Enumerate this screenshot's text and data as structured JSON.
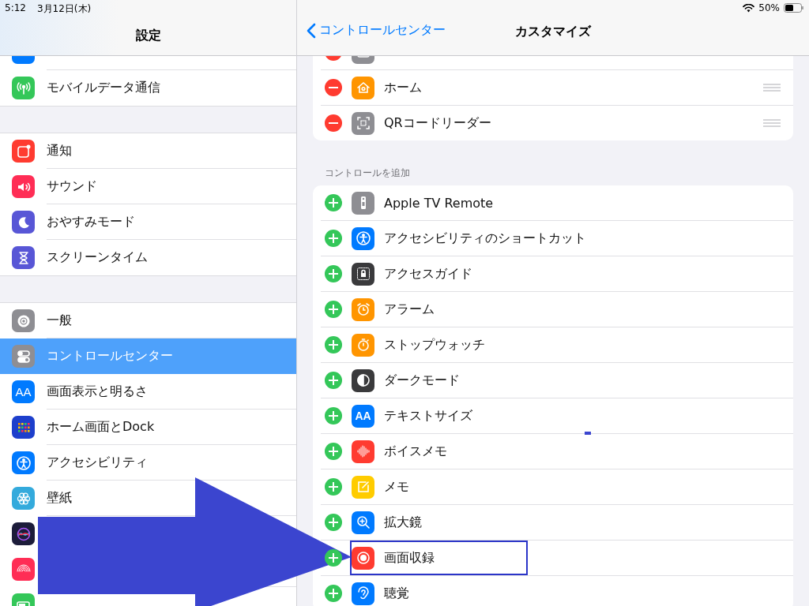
{
  "status_bar": {
    "time": "5:12",
    "date": "3月12日(木)",
    "battery": "50%"
  },
  "sidebar": {
    "title": "設定",
    "groups": [
      [
        {
          "kind": "bluetooth",
          "selected": false
        },
        {
          "kind": "cellular",
          "label": "モバイルデータ通信",
          "selected": false
        }
      ],
      [
        {
          "kind": "notifications",
          "label": "通知",
          "selected": false
        },
        {
          "kind": "sound",
          "label": "サウンド",
          "selected": false
        },
        {
          "kind": "dnd",
          "label": "おやすみモード",
          "selected": false
        },
        {
          "kind": "screentime",
          "label": "スクリーンタイム",
          "selected": false
        }
      ],
      [
        {
          "kind": "general",
          "label": "一般",
          "selected": false
        },
        {
          "kind": "control",
          "label": "コントロールセンター",
          "selected": true
        },
        {
          "kind": "display",
          "icon_text": "AA",
          "label": "画面表示と明るさ",
          "selected": false
        },
        {
          "kind": "homescreen",
          "label": "ホーム画面とDock",
          "selected": false
        },
        {
          "kind": "accessibility",
          "label": "アクセシビリティ",
          "selected": false
        },
        {
          "kind": "wallpaper",
          "label": "壁紙",
          "selected": false
        },
        {
          "kind": "siri",
          "selected": false
        },
        {
          "kind": "touchid",
          "selected": false
        },
        {
          "kind": "battery",
          "selected": false
        }
      ]
    ]
  },
  "detail": {
    "back": "コントロールセンター",
    "title": "カスタマイズ",
    "included": [
      {
        "kind": "camera"
      },
      {
        "kind": "home",
        "label": "ホーム"
      },
      {
        "kind": "qr",
        "label": "QRコードリーダー"
      }
    ],
    "more_header": "コントロールを追加",
    "more": [
      {
        "kind": "remote",
        "label": "Apple TV Remote",
        "highlighted": false
      },
      {
        "kind": "accessibility",
        "label": "アクセシビリティのショートカット",
        "highlighted": false
      },
      {
        "kind": "guided",
        "label": "アクセスガイド",
        "highlighted": false
      },
      {
        "kind": "alarm",
        "label": "アラーム",
        "highlighted": false
      },
      {
        "kind": "stopwatch",
        "label": "ストップウォッチ",
        "highlighted": false
      },
      {
        "kind": "darkmode",
        "label": "ダークモード",
        "highlighted": false
      },
      {
        "kind": "textsize",
        "icon_text": "AA",
        "label": "テキストサイズ",
        "highlighted": false
      },
      {
        "kind": "voicememo",
        "label": "ボイスメモ",
        "highlighted": false
      },
      {
        "kind": "notes",
        "label": "メモ",
        "highlighted": false
      },
      {
        "kind": "magnifier",
        "label": "拡大鏡",
        "highlighted": false
      },
      {
        "kind": "record",
        "label": "画面収録",
        "highlighted": true
      },
      {
        "kind": "hearing",
        "label": "聴覚",
        "highlighted": false
      }
    ]
  }
}
